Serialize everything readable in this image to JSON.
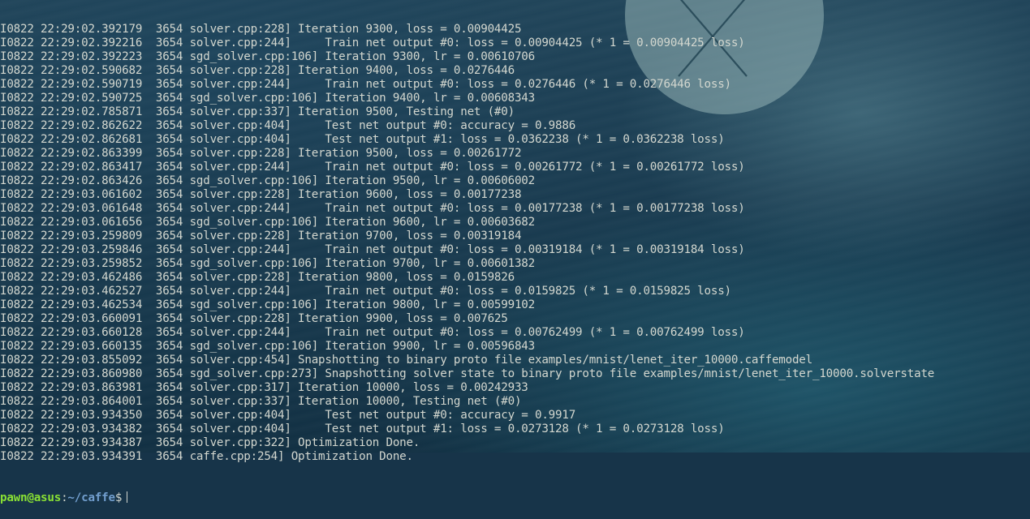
{
  "terminal": {
    "lines": [
      "I0822 22:29:02.392179  3654 solver.cpp:228] Iteration 9300, loss = 0.00904425",
      "I0822 22:29:02.392216  3654 solver.cpp:244]     Train net output #0: loss = 0.00904425 (* 1 = 0.00904425 loss)",
      "I0822 22:29:02.392223  3654 sgd_solver.cpp:106] Iteration 9300, lr = 0.00610706",
      "I0822 22:29:02.590682  3654 solver.cpp:228] Iteration 9400, loss = 0.0276446",
      "I0822 22:29:02.590719  3654 solver.cpp:244]     Train net output #0: loss = 0.0276446 (* 1 = 0.0276446 loss)",
      "I0822 22:29:02.590725  3654 sgd_solver.cpp:106] Iteration 9400, lr = 0.00608343",
      "I0822 22:29:02.785871  3654 solver.cpp:337] Iteration 9500, Testing net (#0)",
      "I0822 22:29:02.862622  3654 solver.cpp:404]     Test net output #0: accuracy = 0.9886",
      "I0822 22:29:02.862681  3654 solver.cpp:404]     Test net output #1: loss = 0.0362238 (* 1 = 0.0362238 loss)",
      "I0822 22:29:02.863399  3654 solver.cpp:228] Iteration 9500, loss = 0.00261772",
      "I0822 22:29:02.863417  3654 solver.cpp:244]     Train net output #0: loss = 0.00261772 (* 1 = 0.00261772 loss)",
      "I0822 22:29:02.863426  3654 sgd_solver.cpp:106] Iteration 9500, lr = 0.00606002",
      "I0822 22:29:03.061602  3654 solver.cpp:228] Iteration 9600, loss = 0.00177238",
      "I0822 22:29:03.061648  3654 solver.cpp:244]     Train net output #0: loss = 0.00177238 (* 1 = 0.00177238 loss)",
      "I0822 22:29:03.061656  3654 sgd_solver.cpp:106] Iteration 9600, lr = 0.00603682",
      "I0822 22:29:03.259809  3654 solver.cpp:228] Iteration 9700, loss = 0.00319184",
      "I0822 22:29:03.259846  3654 solver.cpp:244]     Train net output #0: loss = 0.00319184 (* 1 = 0.00319184 loss)",
      "I0822 22:29:03.259852  3654 sgd_solver.cpp:106] Iteration 9700, lr = 0.00601382",
      "I0822 22:29:03.462486  3654 solver.cpp:228] Iteration 9800, loss = 0.0159826",
      "I0822 22:29:03.462527  3654 solver.cpp:244]     Train net output #0: loss = 0.0159825 (* 1 = 0.0159825 loss)",
      "I0822 22:29:03.462534  3654 sgd_solver.cpp:106] Iteration 9800, lr = 0.00599102",
      "I0822 22:29:03.660091  3654 solver.cpp:228] Iteration 9900, loss = 0.007625",
      "I0822 22:29:03.660128  3654 solver.cpp:244]     Train net output #0: loss = 0.00762499 (* 1 = 0.00762499 loss)",
      "I0822 22:29:03.660135  3654 sgd_solver.cpp:106] Iteration 9900, lr = 0.00596843",
      "I0822 22:29:03.855092  3654 solver.cpp:454] Snapshotting to binary proto file examples/mnist/lenet_iter_10000.caffemodel",
      "I0822 22:29:03.860980  3654 sgd_solver.cpp:273] Snapshotting solver state to binary proto file examples/mnist/lenet_iter_10000.solverstate",
      "I0822 22:29:03.863981  3654 solver.cpp:317] Iteration 10000, loss = 0.00242933",
      "I0822 22:29:03.864001  3654 solver.cpp:337] Iteration 10000, Testing net (#0)",
      "I0822 22:29:03.934350  3654 solver.cpp:404]     Test net output #0: accuracy = 0.9917",
      "I0822 22:29:03.934382  3654 solver.cpp:404]     Test net output #1: loss = 0.0273128 (* 1 = 0.0273128 loss)",
      "I0822 22:29:03.934387  3654 solver.cpp:322] Optimization Done.",
      "I0822 22:29:03.934391  3654 caffe.cpp:254] Optimization Done."
    ],
    "prompt": {
      "user_host": "pawn@asus",
      "separator": ":",
      "path": "~/caffe",
      "symbol": "$"
    }
  },
  "colors": {
    "text": "#d3d7cf",
    "prompt_user": "#8ae234",
    "prompt_path": "#729fcf",
    "background": "#173449"
  },
  "icons": {
    "wallpaper_logo": "os-x-logo"
  }
}
